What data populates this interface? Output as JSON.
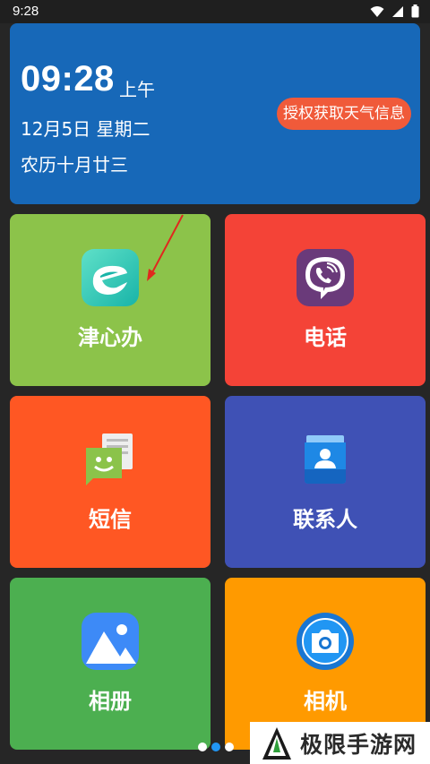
{
  "status_bar": {
    "time": "9:28",
    "icons": [
      "wifi-icon",
      "signal-icon",
      "battery-icon"
    ]
  },
  "clock": {
    "time": "09:28",
    "ampm": "上午",
    "date": "12月5日 星期二",
    "lunar": "农历十月廿三",
    "weather_button": "授权获取天气信息"
  },
  "tiles": [
    {
      "label": "津心办",
      "icon": "jinxinban-app-icon",
      "color": "#8cc34a"
    },
    {
      "label": "电话",
      "icon": "phone-icon",
      "color": "#f44337"
    },
    {
      "label": "短信",
      "icon": "message-icon",
      "color": "#ff5723"
    },
    {
      "label": "联系人",
      "icon": "contacts-icon",
      "color": "#3f51b5"
    },
    {
      "label": "相册",
      "icon": "gallery-icon",
      "color": "#4caf50"
    },
    {
      "label": "相机",
      "icon": "camera-icon",
      "color": "#ff9a00"
    }
  ],
  "pager": {
    "count": 3,
    "active": 1
  },
  "watermark": {
    "text": "极限手游网"
  }
}
